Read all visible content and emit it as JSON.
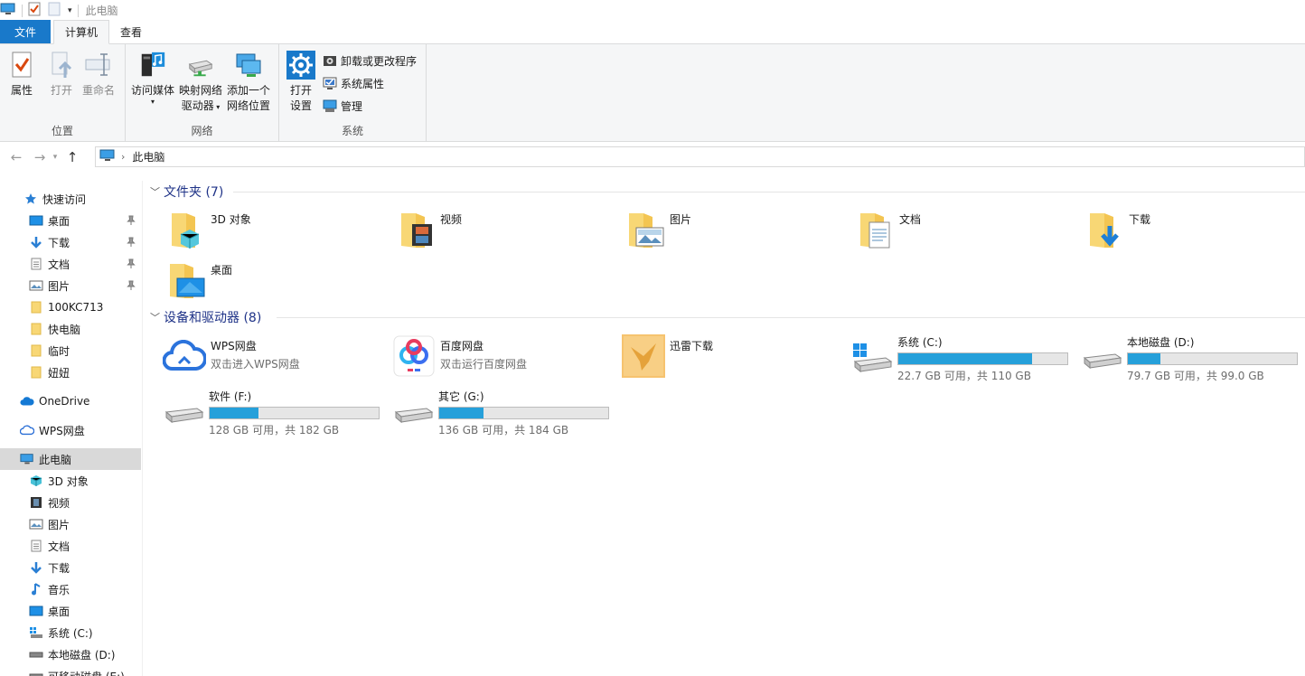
{
  "window": {
    "title": "此电脑"
  },
  "tabs": {
    "file": "文件",
    "computer": "计算机",
    "view": "查看"
  },
  "ribbon": {
    "location": {
      "label": "位置",
      "properties": "属性",
      "open": "打开",
      "rename": "重命名"
    },
    "network": {
      "label": "网络",
      "media": "访问媒体",
      "map_line1": "映射网络",
      "map_line2": "驱动器",
      "add_line1": "添加一个",
      "add_line2": "网络位置"
    },
    "system": {
      "label": "系统",
      "open_line1": "打开",
      "open_line2": "设置",
      "uninstall": "卸载或更改程序",
      "sysprops": "系统属性",
      "manage": "管理"
    }
  },
  "address": {
    "crumb": "此电脑"
  },
  "sidebar": {
    "quick_access": "快速访问",
    "quick_items": [
      "桌面",
      "下载",
      "文档",
      "图片",
      "100KC713",
      "快电脑",
      "临时",
      "妞妞"
    ],
    "onedrive": "OneDrive",
    "wps": "WPS网盘",
    "this_pc": "此电脑",
    "pc_items": [
      "3D 对象",
      "视频",
      "图片",
      "文档",
      "下载",
      "音乐",
      "桌面",
      "系统 (C:)",
      "本地磁盘 (D:)",
      "可移动磁盘 (E:)"
    ]
  },
  "content": {
    "folders_header": "文件夹 (7)",
    "folders": [
      "3D 对象",
      "视频",
      "图片",
      "文档",
      "下载",
      "桌面"
    ],
    "devices_header": "设备和驱动器 (8)",
    "wps_name": "WPS网盘",
    "wps_sub": "双击进入WPS网盘",
    "baidu_name": "百度网盘",
    "baidu_sub": "双击运行百度网盘",
    "xunlei_name": "迅雷下载",
    "drives": [
      {
        "name": "系统 (C:)",
        "info": "22.7 GB 可用，共 110 GB",
        "used_fraction": 0.79
      },
      {
        "name": "本地磁盘 (D:)",
        "info": "79.7 GB 可用，共 99.0 GB",
        "used_fraction": 0.19
      },
      {
        "name": "软件 (F:)",
        "info": "128 GB 可用，共 182 GB",
        "used_fraction": 0.29
      },
      {
        "name": "其它 (G:)",
        "info": "136 GB 可用，共 184 GB",
        "used_fraction": 0.26
      }
    ]
  },
  "colors": {
    "accent": "#1979ca",
    "bar_fill": "#26a0da",
    "header_text": "#1e3287"
  }
}
